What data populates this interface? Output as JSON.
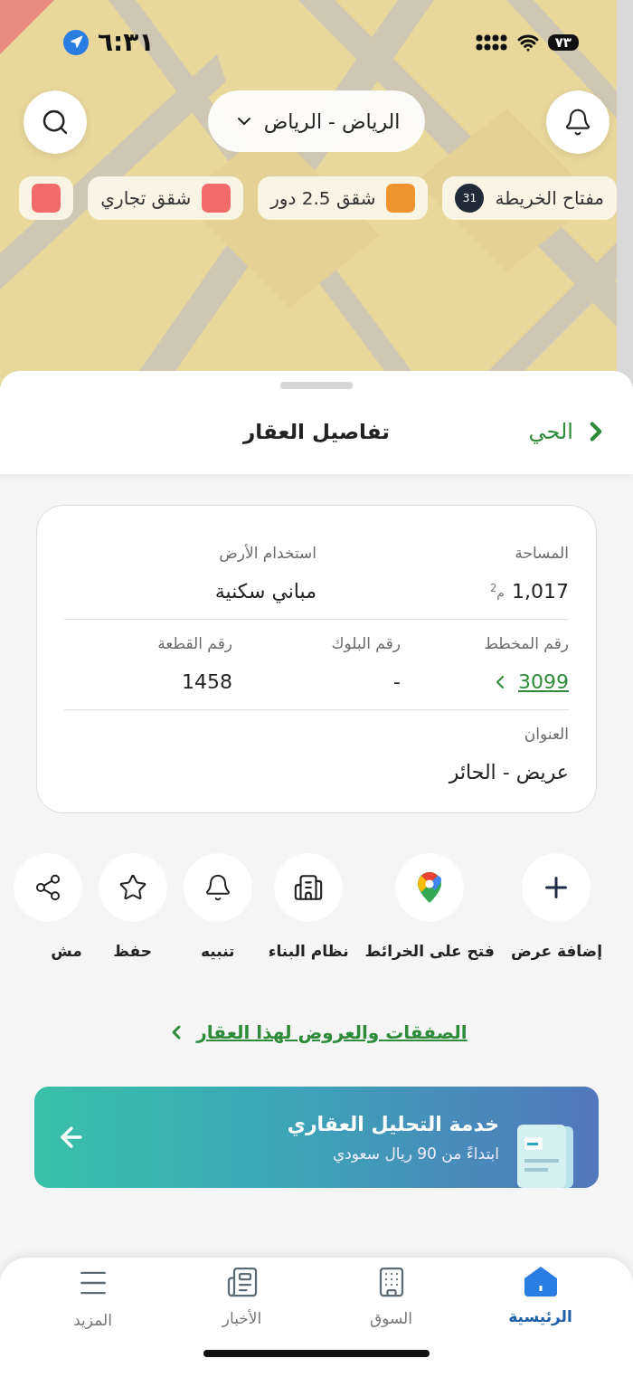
{
  "status_bar": {
    "time": "٦:٣١",
    "battery": "٧٣",
    "location_on": true
  },
  "map": {
    "city": "الرياض - الرياض",
    "chips": [
      {
        "kind": "key",
        "label": "مفتاح الخريطة",
        "count": "31"
      },
      {
        "kind": "category",
        "label": "شقق 2.5 دور",
        "color": "#f0922e"
      },
      {
        "kind": "category",
        "label": "شقق تجاري",
        "color": "#f26b6b"
      },
      {
        "kind": "category",
        "color": "#f26b6b"
      }
    ]
  },
  "header": {
    "title": "تفاصيل العقار",
    "back": "الحي"
  },
  "details": {
    "rows": [
      [
        {
          "label": "المساحة",
          "value": "1,017",
          "unit": "م$^{2}$"
        },
        {
          "label": "استخدام الأرض",
          "value": "مباني سكنية"
        }
      ],
      [
        {
          "label": "رقم المخطط",
          "value": "3099",
          "link": true
        },
        {
          "label": "رقم البلوك",
          "value": "-"
        },
        {
          "label": "رقم القطعة",
          "value": "1458"
        }
      ],
      [
        {
          "label": "العنوان",
          "value": "عريض - الحائر"
        }
      ]
    ]
  },
  "actions": [
    {
      "label": "إضافة عرض"
    },
    {
      "label": "فتح على الخرائط"
    },
    {
      "label": "نظام البناء"
    },
    {
      "label": "تنبيه"
    },
    {
      "label": "حفظ"
    },
    {
      "label": "مش"
    }
  ],
  "deals_link": "الصفقات والعروض لهذا العقار",
  "banner": {
    "title": "خدمة التحليل العقاري",
    "subtitle": "ابتداءً من 90 ريال سعودي"
  },
  "nav": [
    {
      "label": "الرئيسية",
      "selected": true
    },
    {
      "label": "السوق",
      "selected": false
    },
    {
      "label": "الأخبار",
      "selected": false
    },
    {
      "label": "المزيد",
      "selected": false
    }
  ]
}
